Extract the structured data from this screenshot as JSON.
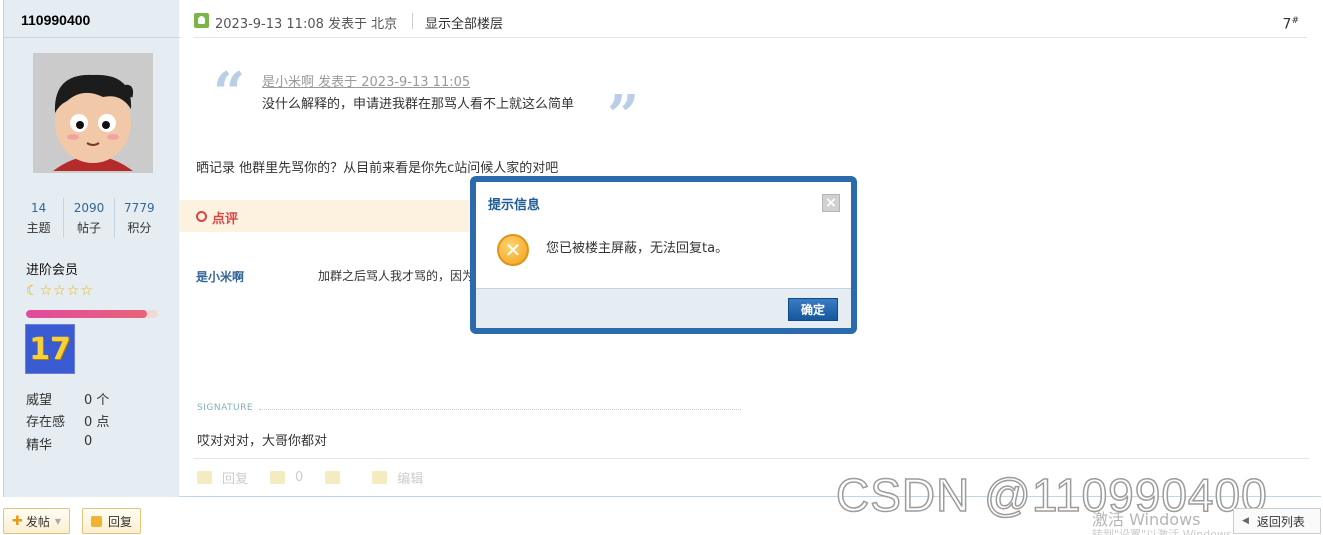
{
  "author": {
    "name": "110990400",
    "stats": [
      {
        "value": "14",
        "label": "主题"
      },
      {
        "value": "2090",
        "label": "帖子"
      },
      {
        "value": "7779",
        "label": "积分"
      }
    ],
    "level": "进阶会员",
    "level_progress": 0.92,
    "medal_text": "17",
    "profile": [
      {
        "label": "威望",
        "value": "0 个"
      },
      {
        "label": "存在感",
        "value": "0 点"
      },
      {
        "label": "精华",
        "value": "0"
      }
    ]
  },
  "post": {
    "meta": "2023-9-13 11:08 发表于 北京",
    "show_all_floors": "显示全部楼层",
    "floor": "7",
    "floor_suffix": "#",
    "quote_author": "是小米啊 发表于 2023-9-13 11:05",
    "quote_text": "没什么解释的，申请进我群在那骂人看不上就这么简单",
    "body": "晒记录 他群里先骂你的？从目前来看是你先c站问候人家的对吧",
    "rate_label": "点评",
    "comment_user": "是小米啊",
    "comment_text": "加群之后骂人我才骂的，因为",
    "signature_label": "SIGNATURE",
    "signature_text": "哎对对对，大哥你都对",
    "actions": {
      "reply": "回复",
      "like_count": "0",
      "edit": "编辑"
    }
  },
  "bottom": {
    "new_post": "发帖",
    "reply": "回复",
    "back_list": "返回列表"
  },
  "watermark": "CSDN @110990400",
  "activate_windows": "激活 Windows",
  "activate_windows_sub": "转到\"设置\"以激活 Windows。",
  "dialog": {
    "title": "提示信息",
    "close": "×",
    "message": "您已被楼主屏蔽，无法回复ta。",
    "ok": "确定"
  },
  "colors": {
    "dialog_border": "#2a6aad",
    "link_blue": "#336699",
    "rate_red": "#dd4444"
  }
}
